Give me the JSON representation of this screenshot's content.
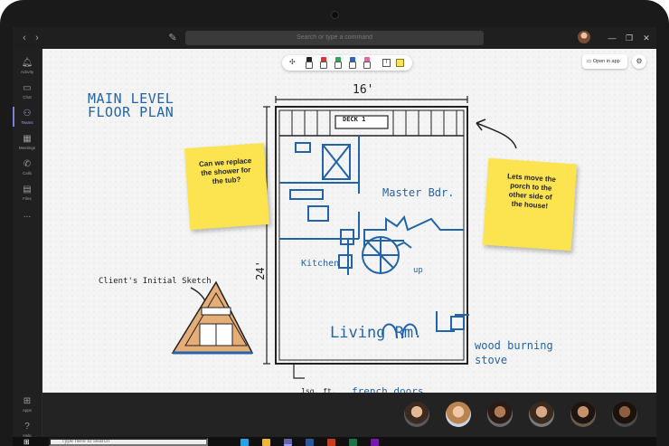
{
  "titlebar": {
    "search_placeholder": "Search or type a command"
  },
  "rail": {
    "items": [
      {
        "label": "Activity",
        "icon": "bell-icon"
      },
      {
        "label": "Chat",
        "icon": "chat-icon"
      },
      {
        "label": "Teams",
        "icon": "teams-icon"
      },
      {
        "label": "Meetings",
        "icon": "calendar-icon"
      },
      {
        "label": "Calls",
        "icon": "phone-icon"
      },
      {
        "label": "Files",
        "icon": "file-icon"
      },
      {
        "label": "...",
        "icon": "more-icon"
      }
    ],
    "bottom_items": [
      {
        "label": "Apps",
        "icon": "apps-icon"
      },
      {
        "label": "Help",
        "icon": "help-icon"
      }
    ]
  },
  "board": {
    "open_in_app_label": "Open in app",
    "title": "MAIN LEVEL\nFLOOR PLAN",
    "width_label": "16'",
    "height_label": "24'",
    "deck_label": "DECK 1",
    "master_label": "Master Bdr.",
    "kitchen_label": "Kitchen",
    "up_label": "up",
    "living_label": "Living Rm.",
    "stove_label": "wood burning\nstove",
    "french_label": "french doors",
    "scale_label": "1sq. ft.",
    "sketch_label": "Client's Initial Sketch",
    "sticky1": "Can we replace\nthe shower for\nthe tub?",
    "sticky2": "Lets move the\nporch to the\nother side of\nthe house!"
  },
  "toolbar": {
    "pens": [
      "#222222",
      "#d93636",
      "#2fa84f",
      "#2c63c7",
      "#e06aa5"
    ]
  },
  "taskbar": {
    "search_placeholder": "Type here to search"
  },
  "colors": {
    "ink_blue": "#2364a8",
    "sticky_yellow": "#fce451",
    "teams_accent": "#7b7fd6"
  }
}
